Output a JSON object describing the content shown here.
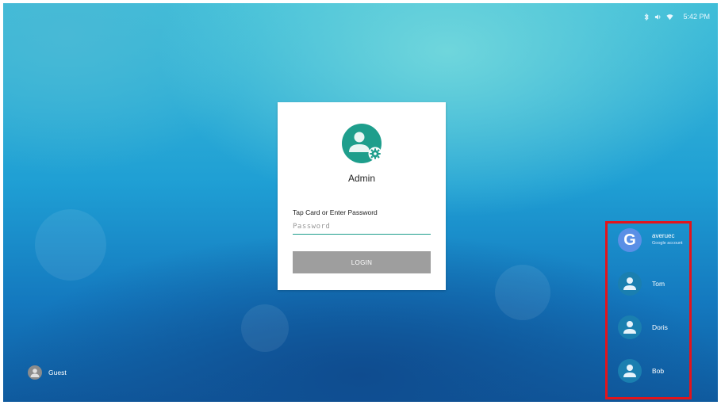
{
  "status_bar": {
    "time": "5:42 PM",
    "icons": [
      "bluetooth-icon",
      "volume-icon",
      "wifi-icon"
    ]
  },
  "login_card": {
    "user_name": "Admin",
    "password_label": "Tap Card or Enter Password",
    "password_placeholder": "Password",
    "login_button": "LOGIN",
    "avatar_icon": "admin-user-gear-icon",
    "accent_color": "#1e9e8c"
  },
  "user_list": {
    "items": [
      {
        "name": "averuec",
        "subtitle": "Google account",
        "icon": "google-icon"
      },
      {
        "name": "Tom",
        "icon": "user-avatar-icon"
      },
      {
        "name": "Doris",
        "icon": "user-avatar-icon"
      },
      {
        "name": "Bob",
        "icon": "user-avatar-icon"
      }
    ],
    "highlight_color": "#e3141b"
  },
  "guest": {
    "label": "Guest",
    "icon": "guest-avatar-icon"
  }
}
